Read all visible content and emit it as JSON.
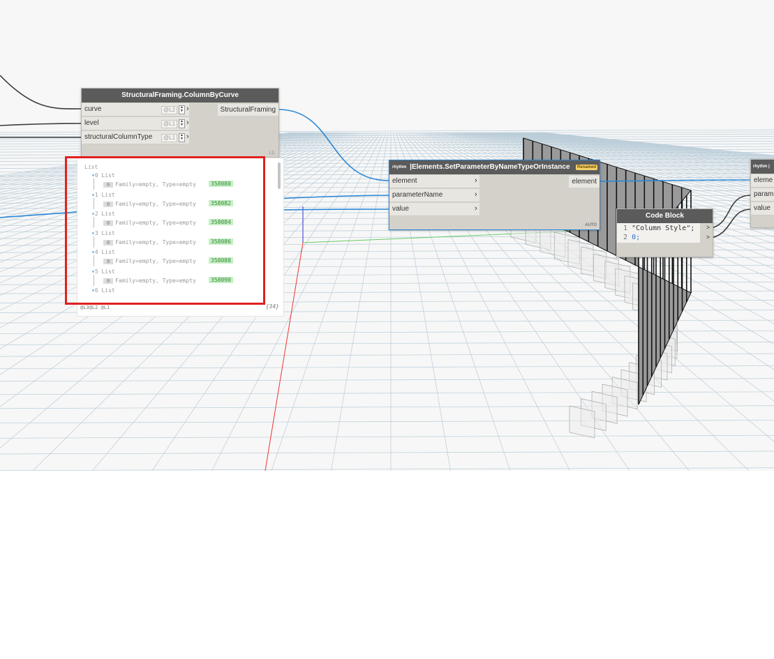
{
  "nodes": {
    "column_by_curve": {
      "title": "StructuralFraming.ColumnByCurve",
      "inputs": [
        {
          "name": "curve",
          "lacing": "@L2"
        },
        {
          "name": "level",
          "lacing": "@L1"
        },
        {
          "name": "structuralColumnType",
          "lacing": "@L1"
        }
      ],
      "output": "StructuralFraming",
      "corner_mark": "L|L"
    },
    "set_parameter": {
      "badge": "rhythm",
      "title": "Elements.SetParameterByNameTypeOrInstance",
      "renamed_label": "Renamed",
      "inputs": [
        "element",
        "parameterName",
        "value"
      ],
      "output": "element",
      "lacing_mode": "AUTO"
    },
    "code_block": {
      "title": "Code Block",
      "lines": [
        {
          "num": "1",
          "code": "\"Column Style\";"
        },
        {
          "num": "2",
          "code": "0;"
        }
      ],
      "outputs": [
        ">",
        ">"
      ]
    },
    "partial_node": {
      "badge": "rhythm",
      "inputs": [
        "eleme",
        "param",
        "value"
      ]
    }
  },
  "preview": {
    "root_label": "List",
    "groups": [
      {
        "index": "0",
        "label": "List",
        "item_index": "0",
        "item_text": "Family=empty, Type=empty",
        "element_id": "358080"
      },
      {
        "index": "1",
        "label": "List",
        "item_index": "0",
        "item_text": "Family=empty, Type=empty",
        "element_id": "358082"
      },
      {
        "index": "2",
        "label": "List",
        "item_index": "0",
        "item_text": "Family=empty, Type=empty",
        "element_id": "358084"
      },
      {
        "index": "3",
        "label": "List",
        "item_index": "0",
        "item_text": "Family=empty, Type=empty",
        "element_id": "358086"
      },
      {
        "index": "4",
        "label": "List",
        "item_index": "0",
        "item_text": "Family=empty, Type=empty",
        "element_id": "358088"
      },
      {
        "index": "5",
        "label": "List",
        "item_index": "0",
        "item_text": "Family=empty, Type=empty",
        "element_id": "358090"
      },
      {
        "index": "6",
        "label": "List"
      }
    ],
    "footer_levels": "@L3@L2 @L1",
    "footer_count": "{34}"
  },
  "colors": {
    "wire_blue": "#2b87d6",
    "wire_dark": "#3b3b3b",
    "node_header": "#5b5b5b",
    "highlight_red": "#e0201f",
    "element_id_green": "#c6f0c6",
    "renamed_badge": "#f5d36b"
  }
}
